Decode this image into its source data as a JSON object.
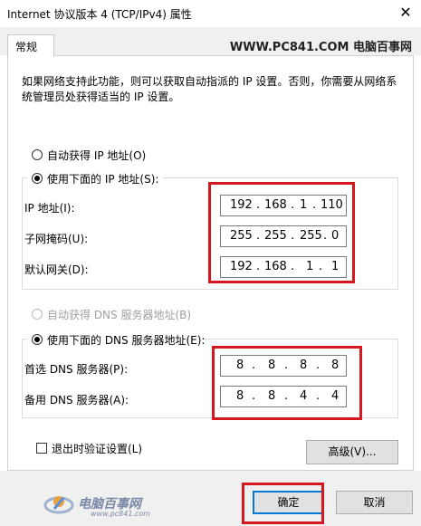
{
  "window": {
    "title": "Internet 协议版本 4 (TCP/IPv4) 属性",
    "close_glyph": "✕"
  },
  "tabs": [
    {
      "label": "常规"
    }
  ],
  "watermark": "WWW.PC841.COM 电脑百事网",
  "description": "如果网络支持此功能，则可以获取自动指派的 IP 设置。否则，你需要从网络系统管理员处获得适当的 IP 设置。",
  "ip_mode": {
    "auto_label": "自动获得 IP 地址(O)",
    "manual_label": "使用下面的 IP 地址(S):",
    "selected": "manual"
  },
  "ip_fields": [
    {
      "label": "IP 地址(I):",
      "octets": [
        "192",
        "168",
        "1",
        "110"
      ]
    },
    {
      "label": "子网掩码(U):",
      "octets": [
        "255",
        "255",
        "255",
        "0"
      ]
    },
    {
      "label": "默认网关(D):",
      "octets": [
        "192",
        "168",
        "1",
        "1"
      ]
    }
  ],
  "dns_mode": {
    "auto_label": "自动获得 DNS 服务器地址(B)",
    "manual_label": "使用下面的 DNS 服务器地址(E):",
    "selected": "manual"
  },
  "dns_fields": [
    {
      "label": "首选 DNS 服务器(P):",
      "octets": [
        "8",
        "8",
        "8",
        "8"
      ]
    },
    {
      "label": "备用 DNS 服务器(A):",
      "octets": [
        "8",
        "8",
        "4",
        "4"
      ]
    }
  ],
  "validate_checkbox": {
    "label": "退出时验证设置(L)",
    "checked": false
  },
  "buttons": {
    "advanced": "高级(V)...",
    "ok": "确定",
    "cancel": "取消"
  },
  "logo": {
    "name": "电脑百事网",
    "url": "www.pc841.com"
  },
  "colors": {
    "highlight_box": "#d4181f",
    "primary_border": "#0078d7"
  }
}
